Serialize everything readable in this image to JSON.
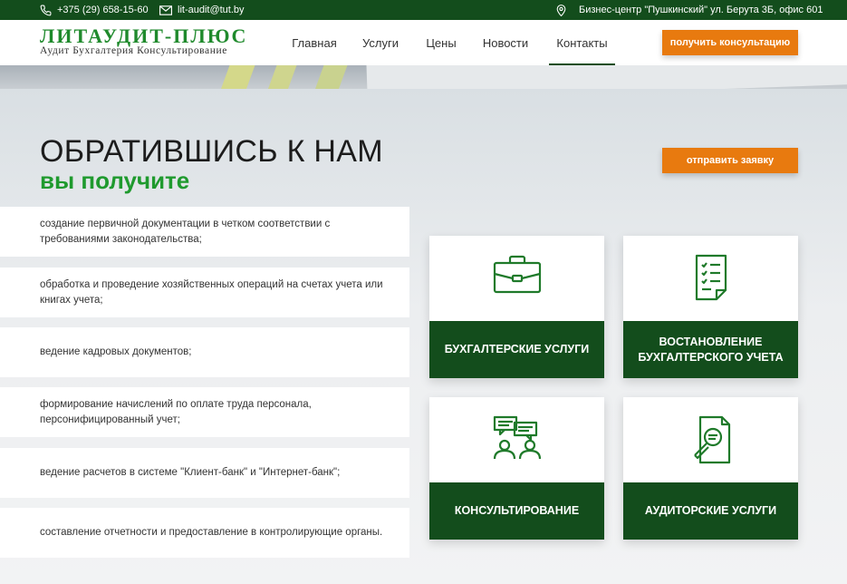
{
  "topbar": {
    "phone": "+375 (29) 658-15-60",
    "email": "lit-audit@tut.by",
    "address": "Бизнес-центр \"Пушкинский\" ул. Берута 3Б, офис 601",
    "icons": [
      "phone-icon",
      "mail-icon",
      "location-pin-icon"
    ]
  },
  "logo": {
    "title": "ЛИТАУДИТ-ПЛЮС",
    "subtitle": "Аудит Бухгалтерия Консультирование"
  },
  "nav": {
    "items": [
      "Главная",
      "Услуги",
      "Цены",
      "Новости",
      "Контакты"
    ],
    "active": "Контакты"
  },
  "header_button": "получить консультацию",
  "main": {
    "heading": "ОБРАТИВШИСЬ К НАМ",
    "subheading": "вы получите",
    "request_button": "отправить заявку"
  },
  "benefits": [
    "создание первичной документации в четком соответствии с требованиями законодательства;",
    "обработка и проведение хозяйственных операций на счетах учета или книгах учета;",
    "ведение кадровых документов;",
    "формирование начислений по оплате труда персонала, персонифицированный учет;",
    "ведение расчетов в системе \"Клиент-банк\" и \"Интернет-банк\";",
    "составление отчетности и предоставление в контролирующие органы."
  ],
  "services": [
    {
      "label": "БУХГАЛТЕРСКИЕ УСЛУГИ",
      "icon": "briefcase-icon"
    },
    {
      "label": "ВОСТАНОВЛЕНИЕ БУХГАЛТЕРСКОГО УЧЕТА",
      "icon": "checklist-document-icon"
    },
    {
      "label": "КОНСУЛЬТИРОВАНИЕ",
      "icon": "consultation-chat-icon"
    },
    {
      "label": "АУДИТОРСКИЕ УСЛУГИ",
      "icon": "document-search-icon"
    }
  ],
  "colors": {
    "brand_green": "#134d1c",
    "accent_green": "#1f9a2e",
    "accent_orange": "#e87a0f"
  }
}
